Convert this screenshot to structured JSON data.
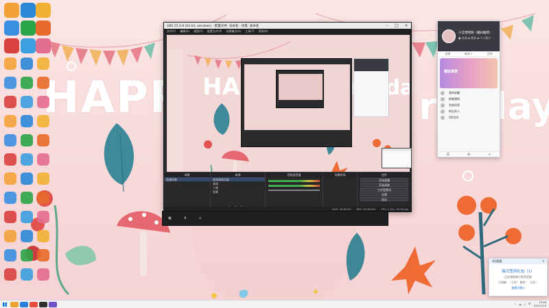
{
  "wallpaper": {
    "text_happy": "HAPPY",
    "text_birthday": "rthday"
  },
  "desktop_icons": [
    {
      "name": "icon-1",
      "color": "#f3a23a",
      "label": ""
    },
    {
      "name": "icon-2",
      "color": "#2b88d8",
      "label": ""
    },
    {
      "name": "icon-3",
      "color": "#f2b033",
      "label": ""
    },
    {
      "name": "icon-4",
      "color": "#3b8fe0",
      "label": ""
    },
    {
      "name": "icon-5",
      "color": "#2aa54a",
      "label": ""
    },
    {
      "name": "icon-6",
      "color": "#e86a2a",
      "label": ""
    },
    {
      "name": "icon-7",
      "color": "#d94040",
      "label": ""
    },
    {
      "name": "icon-8",
      "color": "#3c9fe0",
      "label": ""
    },
    {
      "name": "icon-9",
      "color": "#e36d8f",
      "label": ""
    }
  ],
  "obs": {
    "title": "OBS 25.0.8 (64 bit, windows) - 配置文件: 未命名 - 场景: 未命名",
    "menu": [
      "文件(F)",
      "编辑(E)",
      "视图(V)",
      "配置文件(P)",
      "场景集合(S)",
      "工具(T)",
      "帮助(H)"
    ],
    "preview_happy": "HAPPY",
    "preview_bday": "rthday",
    "docks": {
      "scenes_title": "场景",
      "scenes": [
        "直播场景"
      ],
      "sources_title": "来源",
      "sources": [
        "视频捕获设备",
        "游戏",
        "人物",
        "背景"
      ],
      "mixer_title": "音频混音器",
      "transitions_title": "场景转场",
      "controls_title": "控件",
      "controls": [
        "开始直播",
        "开始录制",
        "工作室模式",
        "设置",
        "退出"
      ]
    },
    "status": [
      "LIVE: 00:00:00",
      "REC: 00:00:00",
      "CPU: 2.5%, 30.00 fps"
    ],
    "footer_icons": [
      "▣",
      "⬆",
      "⌂"
    ]
  },
  "qq": {
    "name": "小艾嗒嗒呀（播妇推荐）",
    "subtitle": "● 在线 ▪ 单身 ▪ 个人简介",
    "tabs": [
      "消息",
      "联系人",
      "空间"
    ],
    "banner": "精彩推荐",
    "items": [
      "我的收藏",
      "群聊通知",
      "系统消息",
      "附近的人",
      "QQ空间"
    ],
    "bottom_icons": [
      "☰",
      "⚙",
      "+"
    ]
  },
  "toast": {
    "header": "QQ提醒",
    "title": "每日签到礼包（1）",
    "lines": [
      "点击领取每日签到奖励",
      "已领取：（1次） 剩余：（2次）",
      "查看详情 ▸"
    ]
  },
  "taskbar": {
    "time": "19:48",
    "date": "2021/12/5",
    "tray": [
      "^",
      "☁",
      "♪",
      "中"
    ],
    "apps": [
      "#f0a030",
      "#2a7fd8",
      "#e84c3d",
      "#2f2f2f",
      "#6c4fc9"
    ]
  }
}
